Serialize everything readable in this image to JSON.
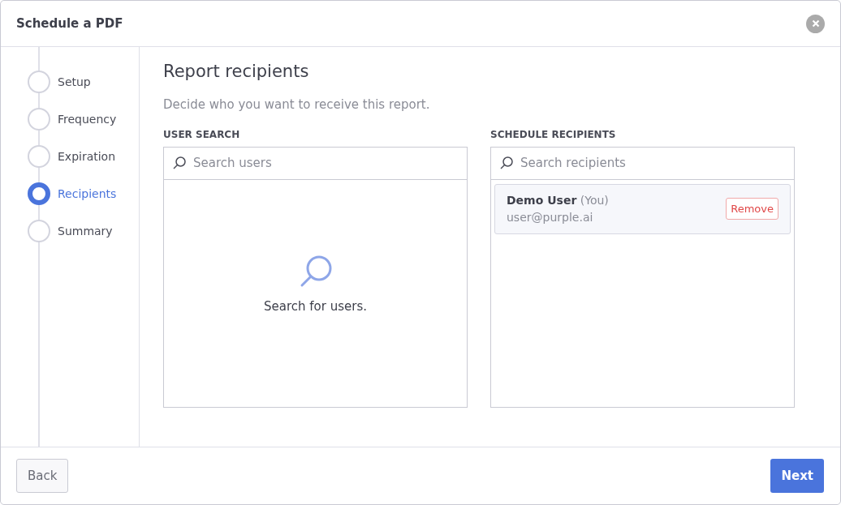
{
  "window": {
    "title": "Schedule a PDF"
  },
  "steps": [
    {
      "label": "Setup",
      "selected": false
    },
    {
      "label": "Frequency",
      "selected": false
    },
    {
      "label": "Expiration",
      "selected": false
    },
    {
      "label": "Recipients",
      "selected": true
    },
    {
      "label": "Summary",
      "selected": false
    }
  ],
  "heading": "Report recipients",
  "subtitle": "Decide who you want to receive this report.",
  "user_search": {
    "label": "USER SEARCH",
    "placeholder": "Search users",
    "empty_text": "Search for users."
  },
  "schedule_recipients": {
    "label": "SCHEDULE RECIPIENTS",
    "placeholder": "Search recipients",
    "recipients": [
      {
        "name": "Demo User",
        "suffix": "(You)",
        "email": "user@purple.ai",
        "action": "Remove"
      }
    ]
  },
  "footer": {
    "back": "Back",
    "next": "Next"
  }
}
